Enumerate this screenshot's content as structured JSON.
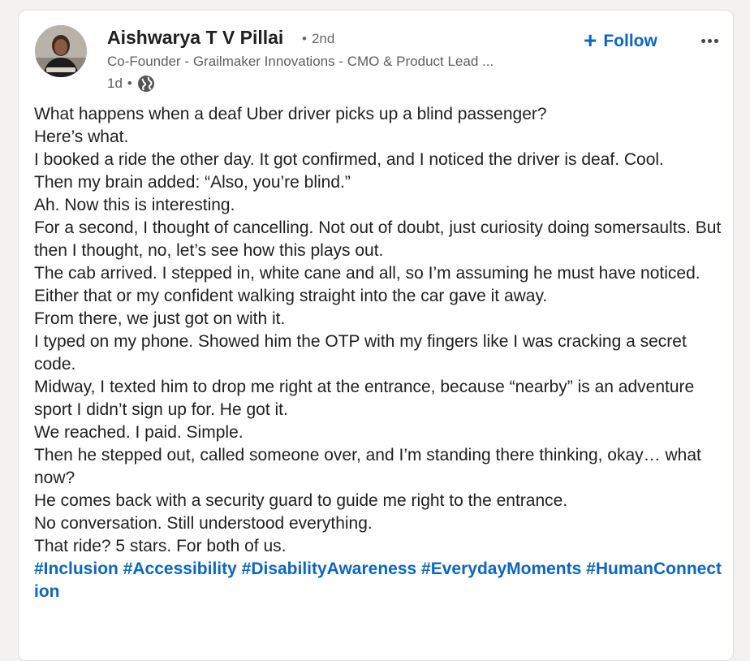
{
  "post": {
    "author": {
      "name": "Aishwarya T V Pillai",
      "degree": "2nd",
      "headline": "Co-Founder - Grailmaker Innovations - CMO & Product Lead ...",
      "time": "1d",
      "visibility_icon": "globe-icon"
    },
    "follow_label": "Follow",
    "more_icon": "more-horizontal-icon",
    "body": [
      "What happens when a deaf Uber driver picks up a blind passenger?",
      "Here’s what.",
      "I booked a ride the other day. It got confirmed, and I noticed the driver is deaf. Cool.",
      "Then my brain added: “Also, you’re blind.”",
      "Ah. Now this is interesting.",
      "For a second, I thought of cancelling. Not out of doubt, just curiosity doing somersaults. But then I thought, no, let’s see how this plays out.",
      "The cab arrived. I stepped in, white cane and all, so I’m assuming he must have noticed. Either that or my confident walking straight into the car gave it away.",
      "From there, we just got on with it.",
      "I typed on my phone. Showed him the OTP with my fingers like I was cracking a secret code.",
      "Midway, I texted him to drop me right at the entrance, because “nearby” is an adventure sport I didn’t sign up for. He got it.",
      "We reached. I paid. Simple.",
      "Then he stepped out, called someone over, and I’m standing there thinking, okay… what now?",
      "He comes back with a security guard to guide me right to the entrance.",
      "No conversation. Still understood everything.",
      "That ride? 5 stars. For both of us."
    ],
    "hashtags": [
      "#Inclusion",
      "#Accessibility",
      "#DisabilityAwareness",
      "#EverydayMoments",
      "#HumanConnection"
    ]
  },
  "colors": {
    "link_blue": "#0a66c2",
    "text": "#1f1f1f",
    "muted": "#5e5e5e",
    "page_bg": "#f4f2ee"
  }
}
